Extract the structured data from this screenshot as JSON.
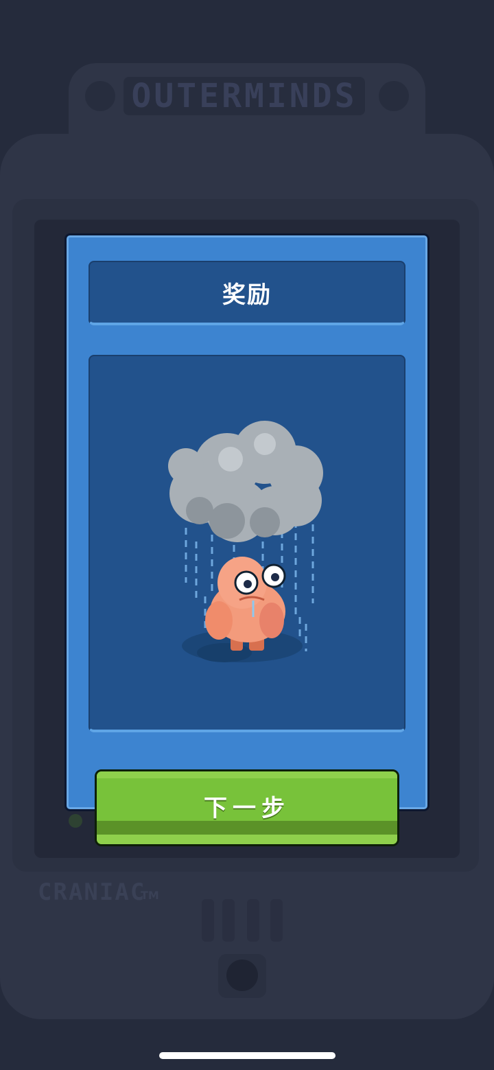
{
  "background_device": {
    "brand": "OUTERMINDS",
    "model": "CRANIAC",
    "trademark": "TM"
  },
  "dialog": {
    "title": "奖励",
    "next_button_label": "下一步",
    "illustration": "rain-cloud-over-sad-character"
  },
  "colors": {
    "panel": "#3d84d0",
    "inner_panel": "#22528c",
    "button_green": "#78c23a",
    "backdrop": "#252b3c"
  }
}
